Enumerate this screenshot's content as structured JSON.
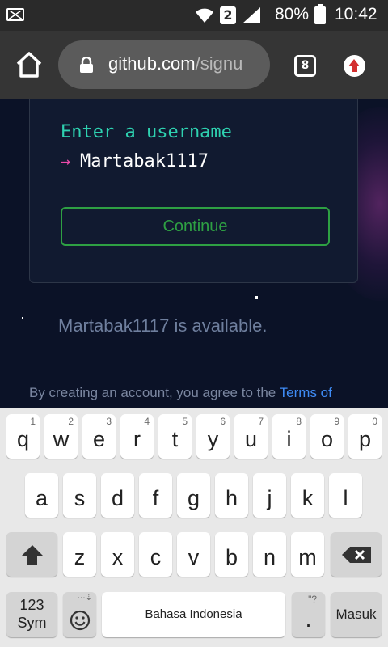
{
  "status_bar": {
    "notification_icon": "email-icon",
    "wifi_icon": "wifi-icon",
    "sim_label": "2",
    "signal_icon": "signal-icon",
    "battery_percent": "80%",
    "battery_icon": "battery-icon",
    "time": "10:42"
  },
  "browser": {
    "url_host": "github.com",
    "url_path": "/signu",
    "tab_count": "8",
    "home_icon": "home-icon",
    "lock_icon": "lock-icon",
    "update_icon": "update-arrow-icon"
  },
  "signup": {
    "prompt": "Enter a username",
    "arrow": "→",
    "username_value": "Martabak1117",
    "continue_label": "Continue",
    "availability_message": "Martabak1117 is available.",
    "terms_text": "By creating an account, you agree to the ",
    "terms_link": "Terms of"
  },
  "keyboard": {
    "row1": [
      {
        "key": "q",
        "hint": "1"
      },
      {
        "key": "w",
        "hint": "2"
      },
      {
        "key": "e",
        "hint": "3"
      },
      {
        "key": "r",
        "hint": "4"
      },
      {
        "key": "t",
        "hint": "5"
      },
      {
        "key": "y",
        "hint": "6"
      },
      {
        "key": "u",
        "hint": "7"
      },
      {
        "key": "i",
        "hint": "8"
      },
      {
        "key": "o",
        "hint": "9"
      },
      {
        "key": "p",
        "hint": "0"
      }
    ],
    "row2": [
      "a",
      "s",
      "d",
      "f",
      "g",
      "h",
      "j",
      "k",
      "l"
    ],
    "row3": [
      "z",
      "x",
      "c",
      "v",
      "b",
      "n",
      "m"
    ],
    "shift_icon": "shift-icon",
    "backspace_icon": "backspace-icon",
    "sym_label_1": "123",
    "sym_label_2": "Sym",
    "emoji_icon": "emoji-icon",
    "space_label": "Bahasa Indonesia",
    "period_label": ".",
    "period_hint": "\"?",
    "enter_label": "Masuk"
  },
  "colors": {
    "accent_green": "#2ea043",
    "prompt_teal": "#2ed1b0",
    "link_blue": "#3f8cf6",
    "arrow_pink": "#ea4aaa"
  }
}
